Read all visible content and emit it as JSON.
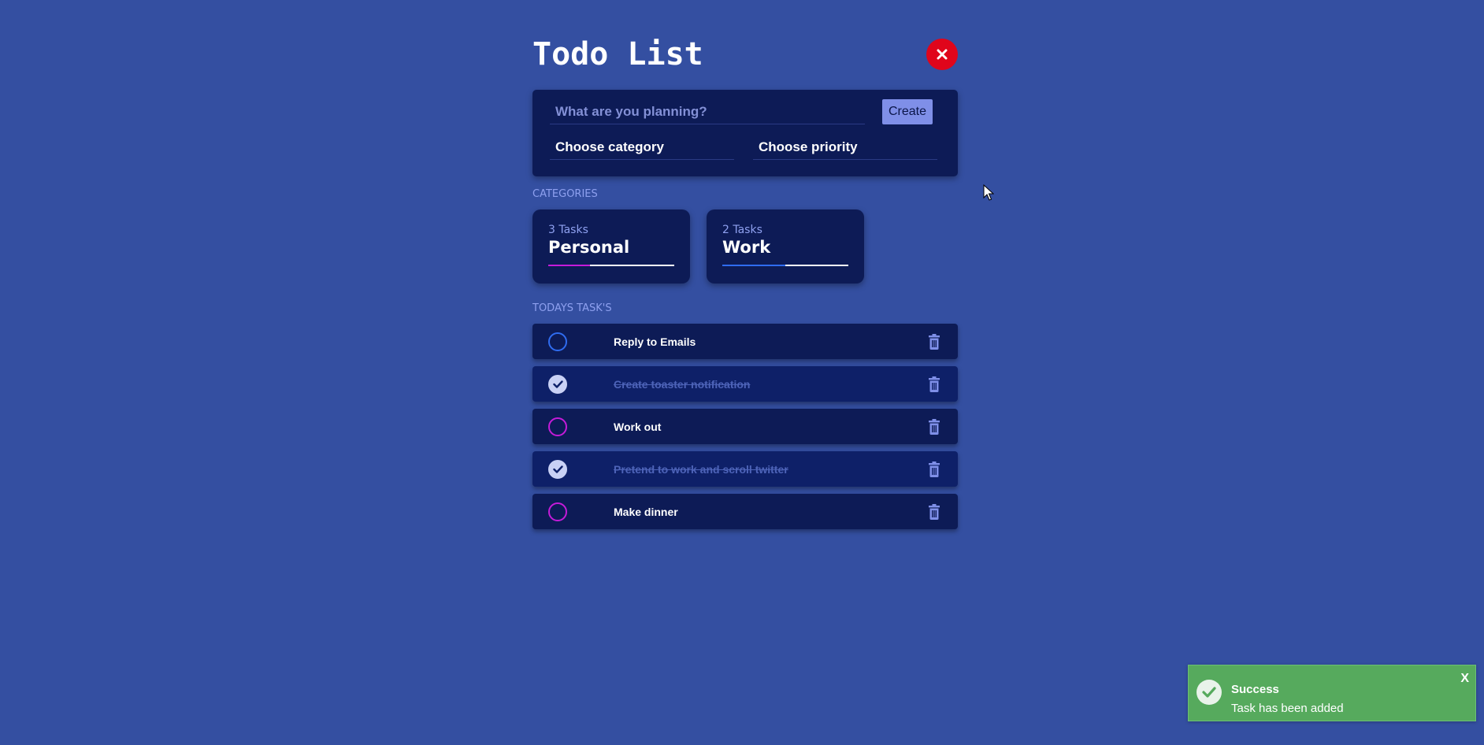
{
  "app": {
    "title": "Todo List"
  },
  "create": {
    "placeholder": "What are you planning?",
    "button_label": "Create",
    "category_label": "Choose category",
    "priority_label": "Choose priority"
  },
  "categories": {
    "heading": "CATEGORIES",
    "items": [
      {
        "count_label": "3 Tasks",
        "name": "Personal",
        "color": "#c51bd9",
        "progress": 0.33
      },
      {
        "count_label": "2 Tasks",
        "name": "Work",
        "color": "#2f6cf0",
        "progress": 0.5
      }
    ]
  },
  "tasks": {
    "heading": "TODAYS TASK'S",
    "items": [
      {
        "text": "Reply to Emails",
        "done": false,
        "category": "Work"
      },
      {
        "text": "Create toaster notification",
        "done": true,
        "category": "Work"
      },
      {
        "text": "Work out",
        "done": false,
        "category": "Personal"
      },
      {
        "text": "Pretend to work and scroll twitter",
        "done": true,
        "category": "Personal"
      },
      {
        "text": "Make dinner",
        "done": false,
        "category": "Personal"
      }
    ]
  },
  "toast": {
    "title": "Success",
    "message": "Task has been added",
    "close_label": "X",
    "color": "#56aa5d"
  },
  "colors": {
    "background": "#344fa1",
    "panel": "#0d1b56",
    "close_button": "#e0051b",
    "work_accent": "#2f6cf0",
    "personal_accent": "#c51bd9"
  },
  "icons": {
    "close": "close-icon",
    "check": "check-icon",
    "trash": "trash-icon",
    "success": "check-circle-icon"
  }
}
